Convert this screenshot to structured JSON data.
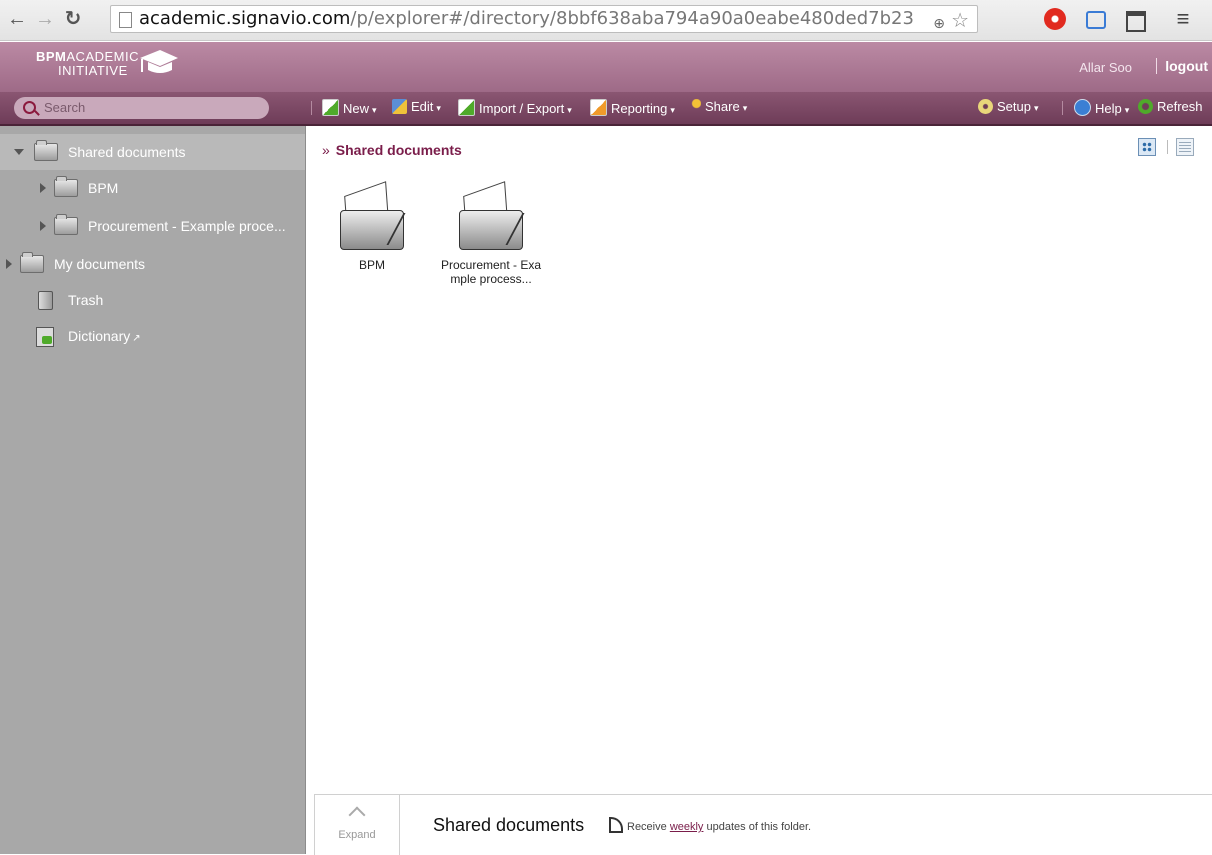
{
  "browser": {
    "url_host": "academic.signavio.com",
    "url_path": "/p/explorer#/directory/8bbf638aba794a90a0eabe480ded7b23"
  },
  "header": {
    "logo_bold": "BPM",
    "logo_light": "ACADEMIC",
    "logo_line2": "INITIATIVE",
    "user_name": "Allar Soo",
    "logout_label": "logout"
  },
  "toolbar": {
    "search_placeholder": "Search",
    "new_label": "New",
    "edit_label": "Edit",
    "import_export_label": "Import / Export",
    "reporting_label": "Reporting",
    "share_label": "Share",
    "setup_label": "Setup",
    "help_label": "Help",
    "refresh_label": "Refresh"
  },
  "sidebar": {
    "items": [
      {
        "label": "Shared documents"
      },
      {
        "label": "BPM"
      },
      {
        "label": "Procurement - Example proce..."
      },
      {
        "label": "My documents"
      },
      {
        "label": "Trash"
      },
      {
        "label": "Dictionary"
      }
    ]
  },
  "main": {
    "breadcrumb": "Shared documents",
    "tiles": [
      {
        "label": "BPM"
      },
      {
        "label": "Procurement - Example process..."
      }
    ]
  },
  "footer": {
    "expand_label": "Expand",
    "title": "Shared documents",
    "text_before": "Receive",
    "link": "weekly",
    "text_after": "updates of this folder."
  },
  "colors": {
    "brand": "#9e6a87",
    "toolbar": "#7a4864",
    "accent": "#7a1d4a"
  }
}
